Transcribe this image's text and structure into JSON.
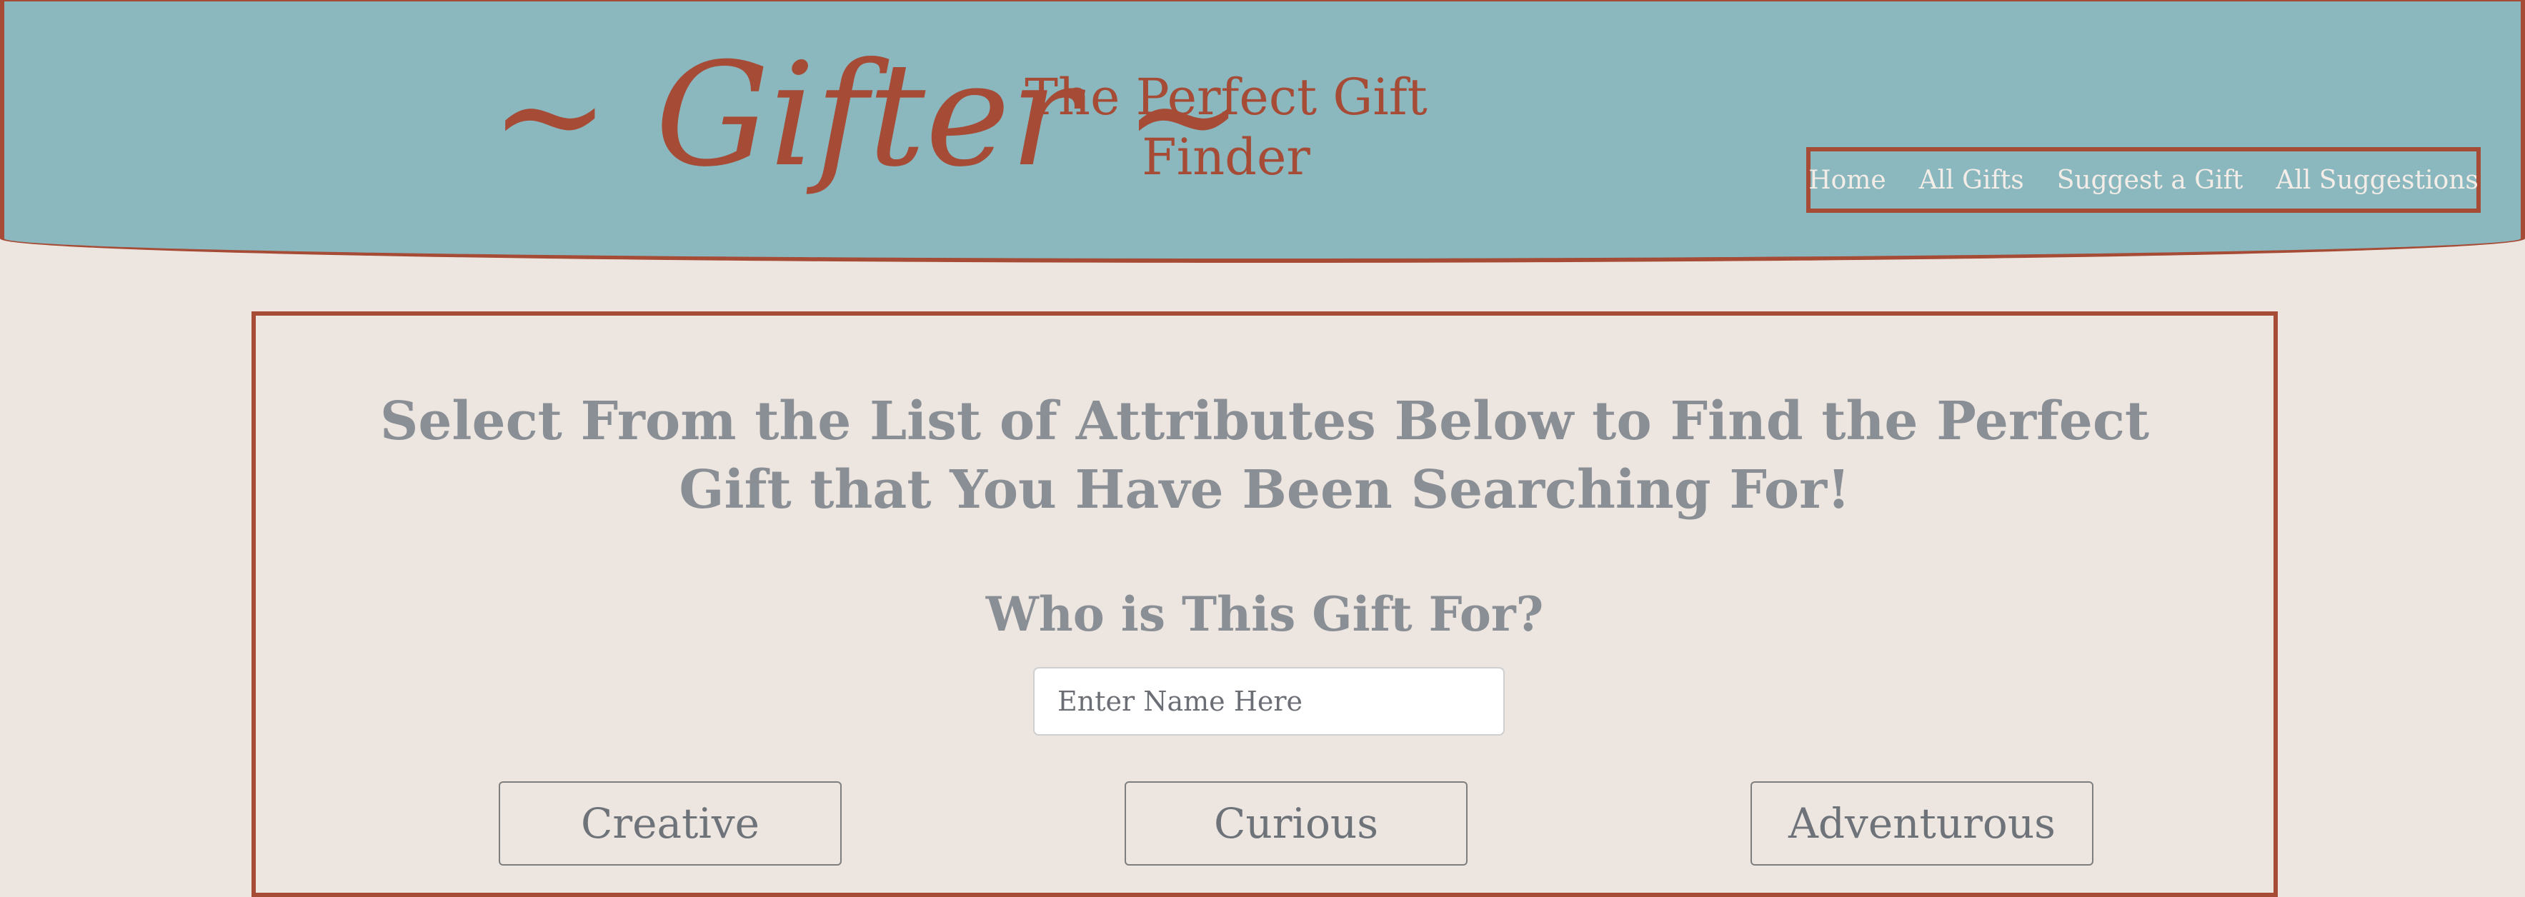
{
  "header": {
    "logo": "~ Gifter ~",
    "tagline": "The Perfect Gift Finder"
  },
  "nav": {
    "items": [
      {
        "label": "Home"
      },
      {
        "label": "All Gifts"
      },
      {
        "label": "Suggest a Gift"
      },
      {
        "label": "All Suggestions"
      }
    ]
  },
  "main": {
    "headline": "Select From the List of Attributes Below to Find the Perfect Gift that You Have Been Searching For!",
    "who_label": "Who is This Gift For?",
    "name_input": {
      "placeholder": "Enter Name Here",
      "value": ""
    },
    "attributes": [
      {
        "label": "Creative"
      },
      {
        "label": "Curious"
      },
      {
        "label": "Adventurous"
      }
    ]
  },
  "colors": {
    "header_bg": "#8BB8BF",
    "accent": "#A64B35",
    "page_bg": "#EDE6E0",
    "text_gray": "#8A8F96"
  }
}
